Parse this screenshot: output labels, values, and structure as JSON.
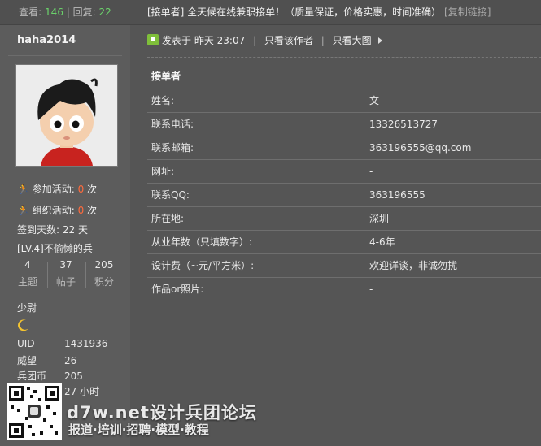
{
  "top": {
    "view_label": "查看:",
    "view_count": "146",
    "separator": "|",
    "reply_label": "回复:",
    "reply_count": "22",
    "thread_title": "[接单者] 全天候在线兼职接单！（质量保证，价格实惠，时间准确）",
    "copy_link": "[复制链接]"
  },
  "user": {
    "name": "haha2014",
    "join_activity_label": "参加活动:",
    "join_activity_count": "0",
    "org_activity_label": "组织活动:",
    "org_activity_count": "0",
    "unit_times": "次",
    "checkin": "签到天数: 22 天",
    "level": "[LV.4]不偷懒的兵",
    "stats": [
      {
        "value": "4",
        "label": "主题"
      },
      {
        "value": "37",
        "label": "帖子"
      },
      {
        "value": "205",
        "label": "积分"
      }
    ],
    "rank": "少尉",
    "details": [
      {
        "key": "UID",
        "value": "1431936"
      },
      {
        "key": "威望",
        "value": "26"
      },
      {
        "key": "兵团币",
        "value": "205"
      },
      {
        "key": "",
        "value": "27 小时"
      }
    ]
  },
  "post": {
    "posted_label": "发表于",
    "posted_time": "昨天 23:07",
    "author_only": "只看该作者",
    "big_image": "只看大图",
    "divider": "|"
  },
  "table": {
    "header": "接单者",
    "rows": [
      {
        "label": "姓名:",
        "value": "文"
      },
      {
        "label": "联系电话:",
        "value": "13326513727"
      },
      {
        "label": "联系邮箱:",
        "value": "363196555@qq.com"
      },
      {
        "label": "网址:",
        "value": "-"
      },
      {
        "label": "联系QQ:",
        "value": "363196555"
      },
      {
        "label": "所在地:",
        "value": "深圳"
      },
      {
        "label": "从业年数（只填数字）:",
        "value": "4-6年"
      },
      {
        "label": "设计费（~元/平方米）:",
        "value": "欢迎详谈，非诚勿扰"
      },
      {
        "label": "作品or照片:",
        "value": "-"
      }
    ]
  },
  "watermark": {
    "title": "d7w.net设计兵团论坛",
    "subtitle": "报道·培训·招聘·模型·教程"
  }
}
